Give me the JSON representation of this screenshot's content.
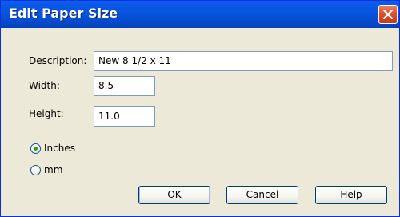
{
  "window": {
    "title": "Edit Paper Size",
    "close_icon": "close-icon"
  },
  "form": {
    "description_label": "Description:",
    "description_value": "New 8 1/2 x 11",
    "width_label": "Width:",
    "width_value": "8.5",
    "height_label": "Height:",
    "height_value": "11.0"
  },
  "units": {
    "options": [
      {
        "label": "Inches",
        "selected": true
      },
      {
        "label": "mm",
        "selected": false
      }
    ]
  },
  "buttons": {
    "ok": "OK",
    "cancel": "Cancel",
    "help": "Help"
  },
  "colors": {
    "titlebar": "#0855dd",
    "close_button": "#e0502e",
    "dialog_bg": "#ece9d8",
    "radio_dot": "#21a121"
  }
}
